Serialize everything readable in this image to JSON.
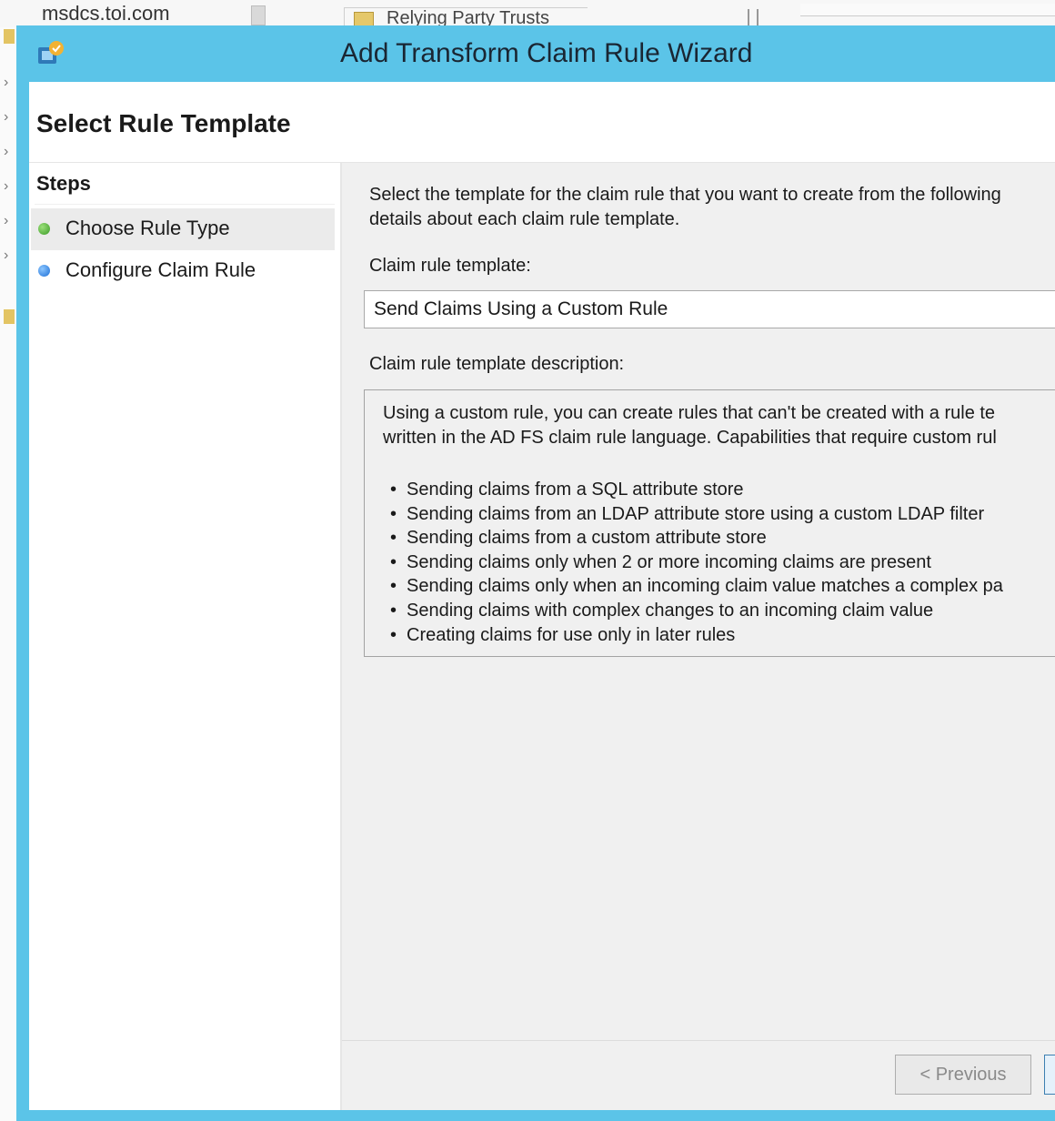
{
  "background": {
    "tree_node": "msdcs.toi.com",
    "folder_label": "Relying Party Trusts"
  },
  "window": {
    "title": "Add Transform Claim Rule Wizard",
    "icon": "adfs-wizard-icon",
    "accent_color": "#5bc4e8"
  },
  "page": {
    "title": "Select Rule Template"
  },
  "steps": {
    "heading": "Steps",
    "items": [
      {
        "label": "Choose Rule Type",
        "status": "current",
        "color": "#3a9a26"
      },
      {
        "label": "Configure Claim Rule",
        "status": "pending",
        "color": "#1d6fd6"
      }
    ]
  },
  "content": {
    "intro_line1": "Select the template for the claim rule that you want to create from the following",
    "intro_line2": "details about each claim rule template.",
    "template_label": "Claim rule template:",
    "template_value": "Send Claims Using a Custom Rule",
    "description_label": "Claim rule template description:",
    "description_line1": "Using a custom rule, you can create rules that can't be created with a rule te",
    "description_line2": "written in the AD FS claim rule language.  Capabilities that require custom rul",
    "bullets": [
      "Sending claims from a SQL attribute store",
      "Sending claims from an LDAP attribute store using a custom LDAP filter",
      "Sending claims from a custom attribute store",
      "Sending claims only when 2 or more incoming claims are present",
      "Sending claims only when an incoming claim value matches a complex pa",
      "Sending claims with complex changes to an incoming claim value",
      "Creating claims for use only in later rules"
    ]
  },
  "footer": {
    "previous_label": "< Previous",
    "next_label": ""
  }
}
